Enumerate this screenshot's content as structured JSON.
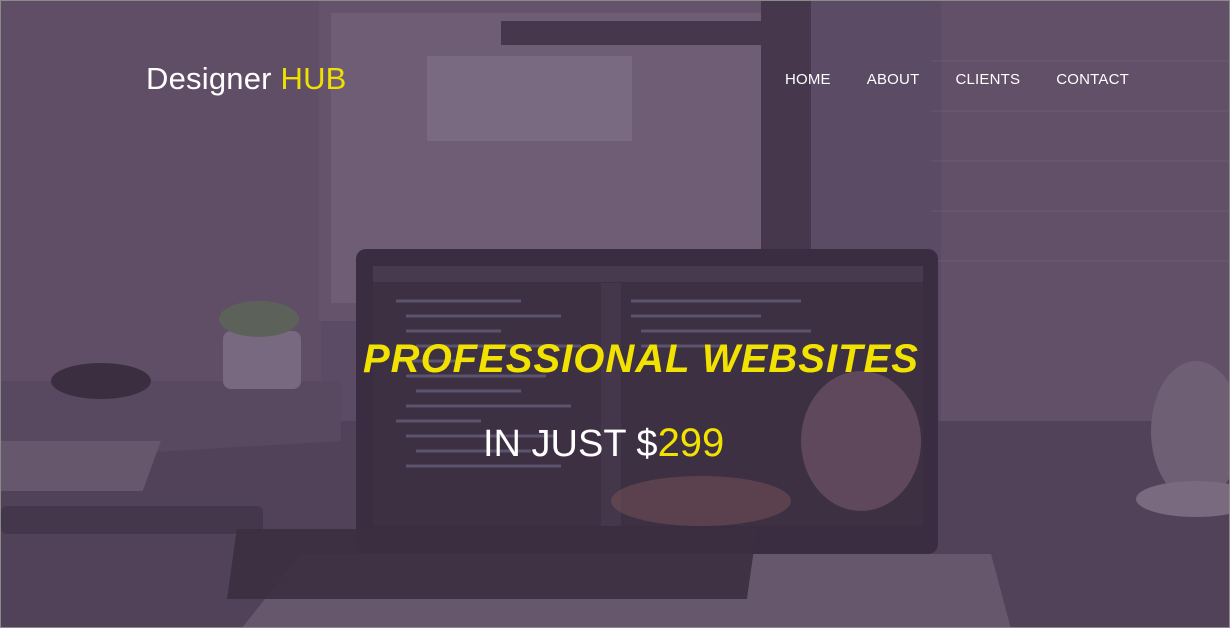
{
  "brand": {
    "name_main": "Designer",
    "name_accent": "HUB"
  },
  "nav": {
    "items": [
      {
        "label": "HOME"
      },
      {
        "label": "ABOUT"
      },
      {
        "label": "CLIENTS"
      },
      {
        "label": "CONTACT"
      }
    ]
  },
  "hero": {
    "headline": "PROFESSIONAL WEBSITES",
    "subline_prefix": "IN JUST $",
    "price": "299"
  },
  "colors": {
    "accent": "#f2e200",
    "overlay": "#5a4b60",
    "text": "#ffffff"
  }
}
